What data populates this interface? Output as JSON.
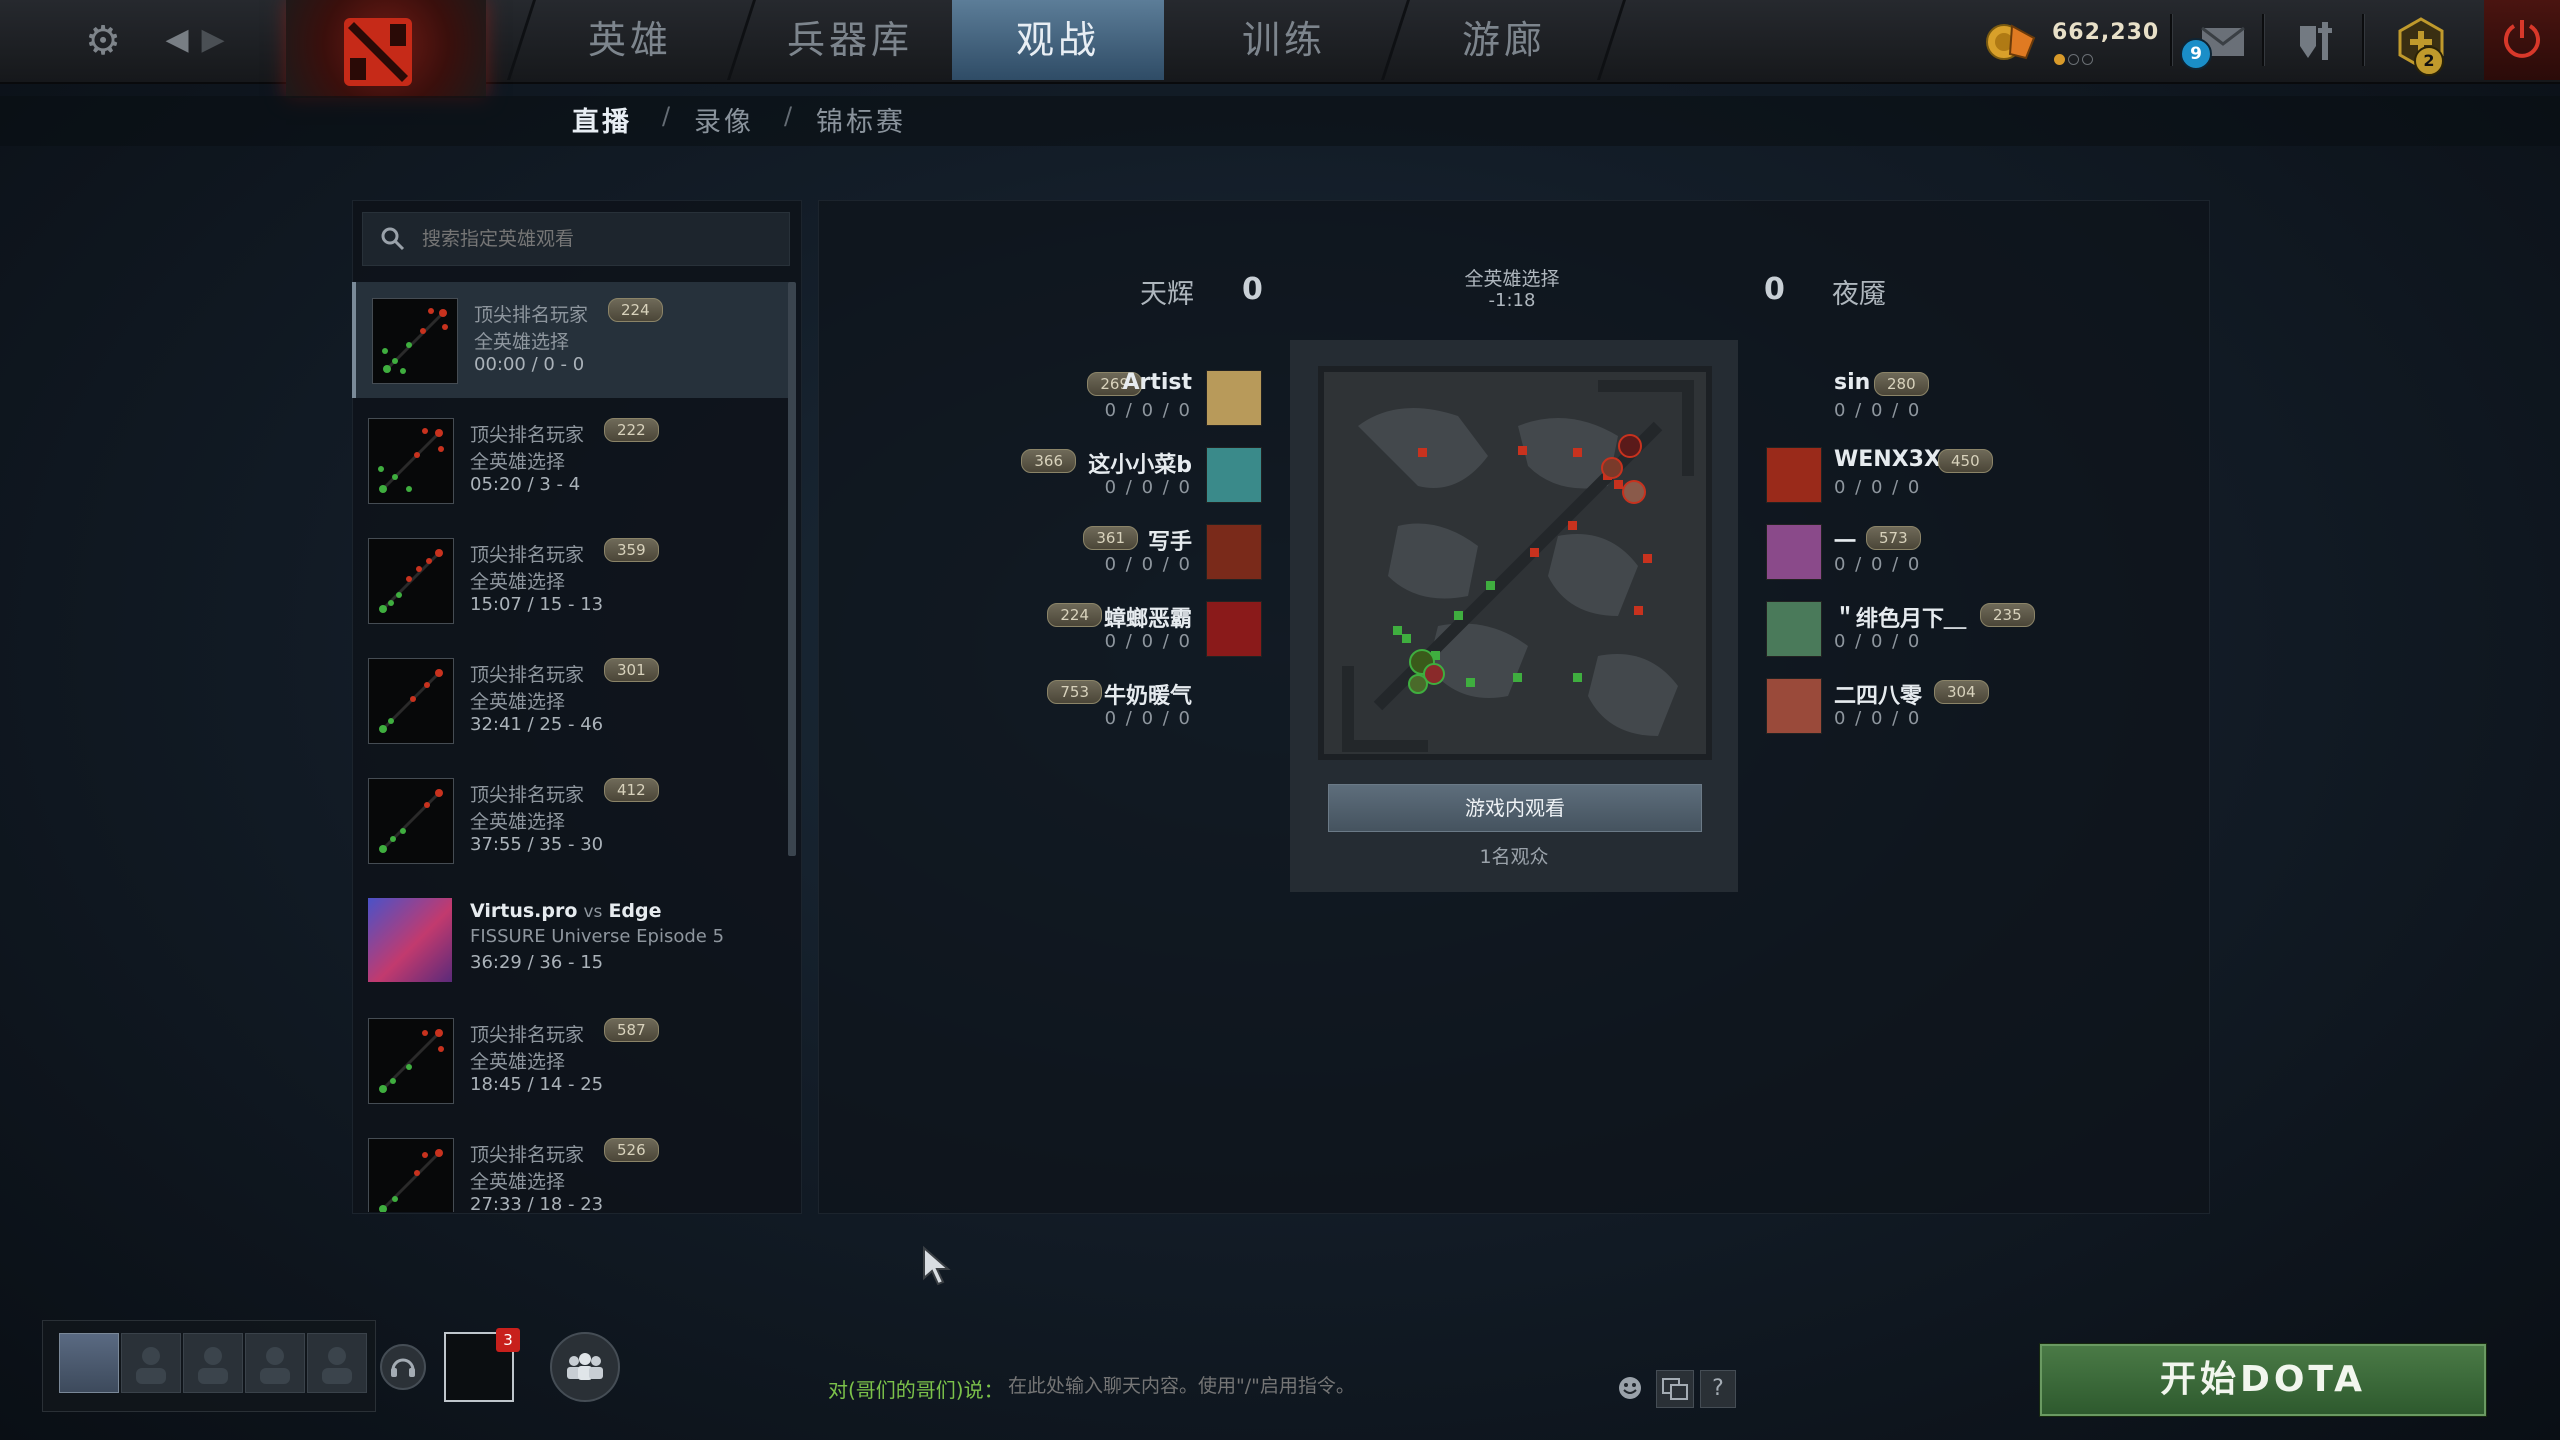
{
  "topnav": {
    "tabs": [
      "英雄",
      "兵器库",
      "观战",
      "训练",
      "游廊"
    ],
    "active_tab": "观战",
    "currency": "662,230",
    "mail_badge": "9",
    "quest_badge": "2"
  },
  "subnav": {
    "items": [
      "直播",
      "录像",
      "锦标赛"
    ],
    "active": "直播",
    "separator": "/"
  },
  "search": {
    "placeholder": "搜索指定英雄观看"
  },
  "live_games": [
    {
      "title": "顶尖排名玩家",
      "mmr": "224",
      "mode": "全英雄选择",
      "status": "00:00 / 0 - 0",
      "selected": true
    },
    {
      "title": "顶尖排名玩家",
      "mmr": "222",
      "mode": "全英雄选择",
      "status": "05:20 / 3 - 4"
    },
    {
      "title": "顶尖排名玩家",
      "mmr": "359",
      "mode": "全英雄选择",
      "status": "15:07 / 15 - 13"
    },
    {
      "title": "顶尖排名玩家",
      "mmr": "301",
      "mode": "全英雄选择",
      "status": "32:41 / 25 - 46"
    },
    {
      "title": "顶尖排名玩家",
      "mmr": "412",
      "mode": "全英雄选择",
      "status": "37:55 / 35 - 30"
    },
    {
      "team1": "Virtus.pro",
      "vs": "vs",
      "team2": "Edge",
      "mode": "FISSURE Universe Episode 5",
      "status": "36:29 / 36 - 15"
    },
    {
      "title": "顶尖排名玩家",
      "mmr": "587",
      "mode": "全英雄选择",
      "status": "18:45 / 14 - 25"
    },
    {
      "title": "顶尖排名玩家",
      "mmr": "526",
      "mode": "全英雄选择",
      "status": "27:33 / 18 - 23"
    }
  ],
  "match": {
    "radiant_name": "天辉",
    "radiant_score": "0",
    "dire_name": "夜魇",
    "dire_score": "0",
    "mode": "全英雄选择",
    "time": "-1:18",
    "watch_label": "游戏内观看",
    "spectators": "1名观众",
    "radiant_players": [
      {
        "name": "Artist",
        "mmr": "269",
        "kda": "0 / 0 / 0",
        "hero_color": "#b89a5a"
      },
      {
        "name": "这小小菜b",
        "mmr": "366",
        "kda": "0 / 0 / 0",
        "hero_color": "#3a8a8a"
      },
      {
        "name": "写手",
        "mmr": "361",
        "kda": "0 / 0 / 0",
        "hero_color": "#7a2a1a"
      },
      {
        "name": "蟑螂恶霸",
        "mmr": "224",
        "kda": "0 / 0 / 0",
        "hero_color": "#8a1a1a"
      },
      {
        "name": "牛奶暖气",
        "mmr": "753",
        "kda": "0 / 0 / 0",
        "hero_color": ""
      }
    ],
    "dire_players": [
      {
        "name": "sin",
        "mmr": "280",
        "kda": "0 / 0 / 0",
        "hero_color": ""
      },
      {
        "name": "WENX3X",
        "mmr": "450",
        "kda": "0 / 0 / 0",
        "hero_color": "#9a2a1a"
      },
      {
        "name": "一",
        "mmr": "573",
        "kda": "0 / 0 / 0",
        "hero_color": "#8a4a8a"
      },
      {
        "name": "＂绯色月下＿",
        "mmr": "235",
        "kda": "0 / 0 / 0",
        "hero_color": "#4a7a5a"
      },
      {
        "name": "二四八零",
        "mmr": "304",
        "kda": "0 / 0 / 0",
        "hero_color": "#9a4a3a"
      }
    ]
  },
  "bottom": {
    "chat_badge": "3",
    "chat_prefix": "对(哥们的哥们)说：",
    "chat_placeholder": "在此处输入聊天内容。使用\"/\"启用指令。",
    "help_label": "?",
    "start_label": "开始DOTA"
  },
  "colors": {
    "accent_green": "#7cc24a",
    "start_green": "#3e6e3c",
    "active_tab_blue": "#4e6f8c",
    "radiant_green": "#3fae3f",
    "dire_red": "#c8321e"
  }
}
